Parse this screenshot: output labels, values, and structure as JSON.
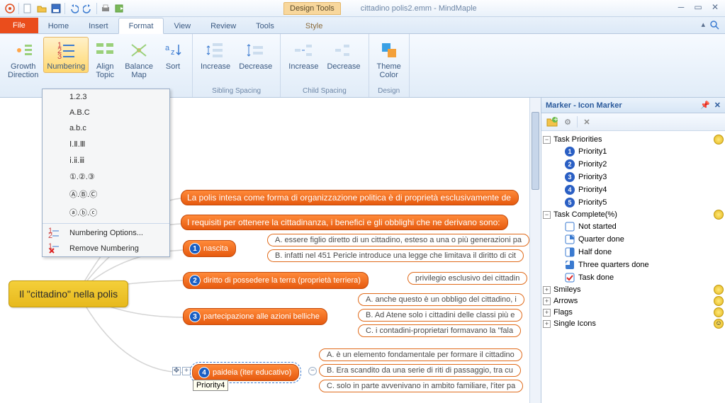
{
  "window": {
    "title": "cittadino polis2.emm - MindMaple",
    "design_tools": "Design Tools"
  },
  "tabs": {
    "file": "File",
    "home": "Home",
    "insert": "Insert",
    "format": "Format",
    "view": "View",
    "review": "Review",
    "tools": "Tools",
    "style": "Style"
  },
  "ribbon": {
    "growth": "Growth\nDirection",
    "numbering": "Numbering",
    "align": "Align\nTopic",
    "balance": "Balance\nMap",
    "sort": "Sort",
    "sib_inc": "Increase",
    "sib_dec": "Decrease",
    "sib_grp": "Sibling Spacing",
    "ch_inc": "Increase",
    "ch_dec": "Decrease",
    "ch_grp": "Child Spacing",
    "theme": "Theme\nColor",
    "design_grp": "Design"
  },
  "dropdown": {
    "i1": "1.2.3",
    "i2": "A.B.C",
    "i3": "a.b.c",
    "i4": "Ⅰ.Ⅱ.Ⅲ",
    "i5": "ⅰ.ⅱ.ⅲ",
    "i6": "①.②.③",
    "i7": "Ⓐ.Ⓑ.Ⓒ",
    "i8": "ⓐ.ⓑ.ⓒ",
    "opt": "Numbering Options...",
    "rem": "Remove Numbering"
  },
  "map": {
    "central": "Il \"cittadino\" nella polis",
    "b1": "La polis intesa come forma di organizzazione politica è di proprietà esclusivamente de",
    "b2": "I requisiti per ottenere la cittadinanza, i benefici e gli obblighi che ne derivano sono:",
    "n1": "nascita",
    "n2": "diritto di possedere la terra (proprietà terriera)",
    "n3": "partecipazione alle azioni belliche",
    "n4": "paideia (iter educativo)",
    "l1a": "A.   essere figlio diretto di un cittadino, esteso a una o più generazioni pa",
    "l1b": "B.   infatti nel 451 Pericle introduce una legge che limitava il diritto di cit",
    "l2a": "privilegio esclusivo dei cittadin",
    "l3a": "A.   anche questo è un obbligo del cittadino, i",
    "l3b": "B.   Ad Atene solo i cittadini delle classi più e",
    "l3c": "C.   i contadini-proprietari formavano la \"fala",
    "l4a": "A.   è un elemento fondamentale per formare il cittadino",
    "l4b": "B.   Era scandito da una serie di riti di passaggio, tra cu",
    "l4c": "C.   solo in parte avvenivano in ambito familiare, l'iter pa",
    "tooltip": "Priority4"
  },
  "panel": {
    "title": "Marker - Icon Marker",
    "g1": "Task Priorities",
    "p1": "Priority1",
    "p2": "Priority2",
    "p3": "Priority3",
    "p4": "Priority4",
    "p5": "Priority5",
    "g2": "Task Complete(%)",
    "c1": "Not started",
    "c2": "Quarter done",
    "c3": "Half done",
    "c4": "Three quarters done",
    "c5": "Task done",
    "g3": "Smileys",
    "g4": "Arrows",
    "g5": "Flags",
    "g6": "Single Icons"
  }
}
